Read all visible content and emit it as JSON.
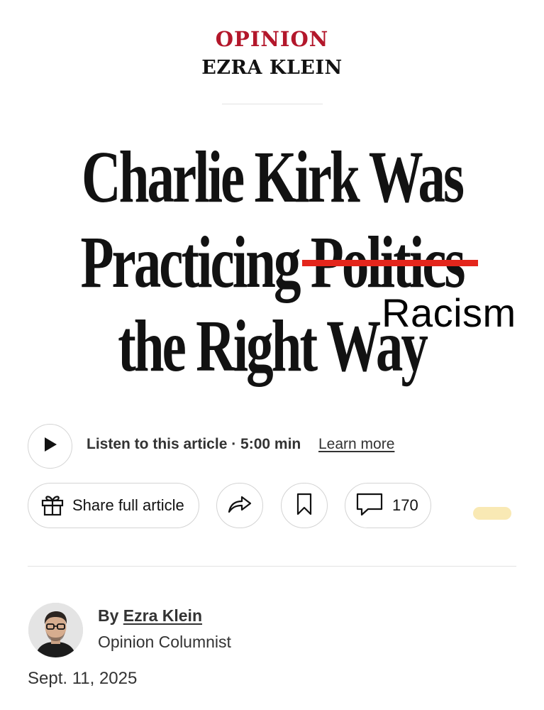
{
  "header": {
    "section": "OPINION",
    "columnist": "EZRA KLEIN",
    "section_color": "#b3172b"
  },
  "headline": {
    "line1": "Charlie Kirk Was",
    "line2": "Practicing Politics",
    "line3": "the Right Way",
    "struck_word": "Politics",
    "replacement_word": "Racism",
    "strike_color": "#e4261c"
  },
  "audio": {
    "listen_label": "Listen to this article · 5:00 min",
    "learn_more": "Learn more"
  },
  "actions": {
    "share_full_label": "Share full article",
    "comment_count": "170"
  },
  "author": {
    "by": "By",
    "name": "Ezra Klein",
    "role": "Opinion Columnist",
    "date": "Sept. 11, 2025"
  },
  "icons": {
    "play": "play-icon",
    "gift": "gift-icon",
    "share": "share-icon",
    "bookmark": "bookmark-icon",
    "comment": "comment-icon"
  }
}
